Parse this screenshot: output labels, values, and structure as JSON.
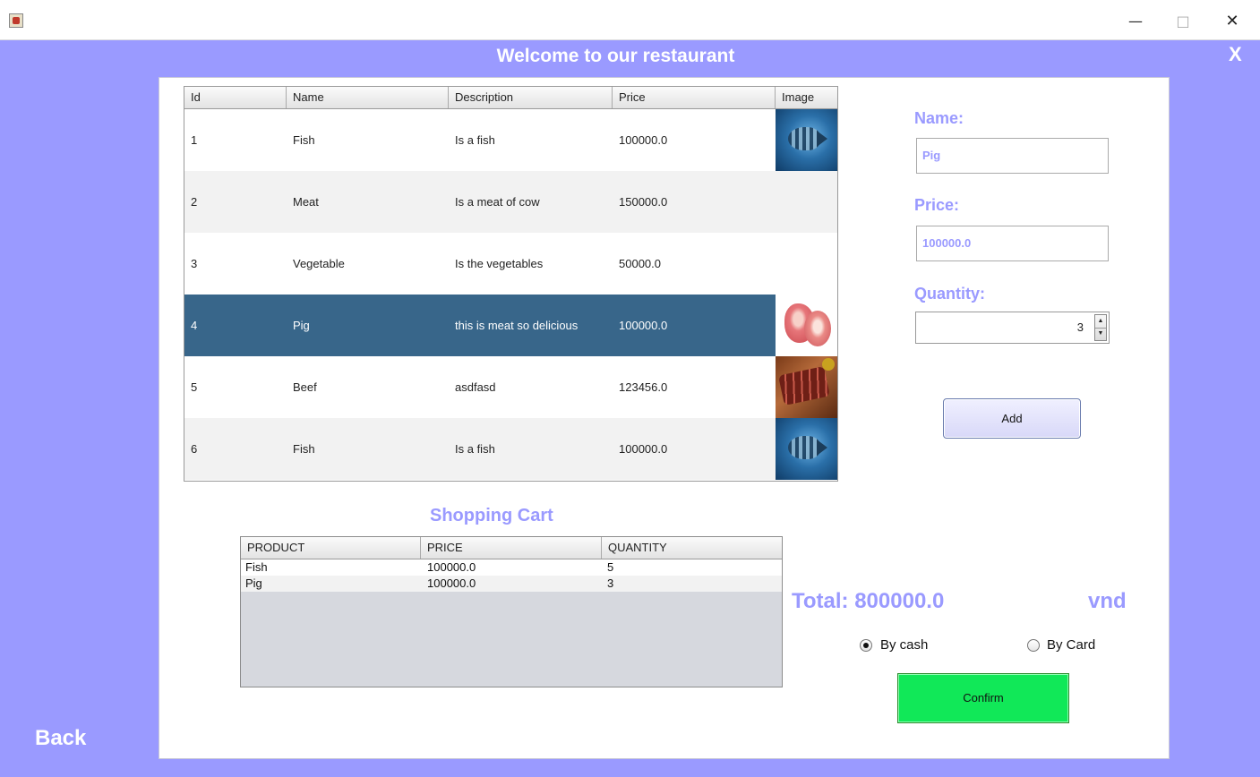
{
  "window": {
    "minimize_glyph": "—",
    "maximize_glyph": "□",
    "close_glyph": "✕"
  },
  "header": {
    "title": "Welcome to our restaurant",
    "close_label": "X"
  },
  "back_label": "Back",
  "menu_table": {
    "columns": [
      "Id",
      "Name",
      "Description",
      "Price",
      "Image"
    ],
    "rows": [
      {
        "id": "1",
        "name": "Fish",
        "description": "Is a fish",
        "price": "100000.0",
        "image": "fish-image"
      },
      {
        "id": "2",
        "name": "Meat",
        "description": "Is a meat of cow",
        "price": "150000.0",
        "image": ""
      },
      {
        "id": "3",
        "name": "Vegetable",
        "description": "Is the vegetables",
        "price": "50000.0",
        "image": ""
      },
      {
        "id": "4",
        "name": "Pig",
        "description": "this is meat so delicious",
        "price": "100000.0",
        "image": "pork-image"
      },
      {
        "id": "5",
        "name": "Beef",
        "description": "asdfasd",
        "price": "123456.0",
        "image": "beef-image"
      },
      {
        "id": "6",
        "name": "Fish",
        "description": "Is a fish",
        "price": "100000.0",
        "image": "fish-image"
      }
    ],
    "selected_row_index": 3
  },
  "form": {
    "name_label": "Name:",
    "name_value": "Pig",
    "price_label": "Price:",
    "price_value": "100000.0",
    "quantity_label": "Quantity:",
    "quantity_value": "3",
    "add_label": "Add"
  },
  "cart": {
    "title": "Shopping Cart",
    "columns": [
      "PRODUCT",
      "PRICE",
      "QUANTITY"
    ],
    "rows": [
      {
        "product": "Fish",
        "price": "100000.0",
        "quantity": "5"
      },
      {
        "product": "Pig",
        "price": "100000.0",
        "quantity": "3"
      }
    ]
  },
  "total": {
    "label": "Total: 800000.0",
    "currency": "vnd"
  },
  "payment": {
    "options": [
      {
        "label": "By cash",
        "selected": true
      },
      {
        "label": "By Card",
        "selected": false
      }
    ],
    "confirm_label": "Confirm"
  },
  "colors": {
    "background": "#9a9aff",
    "accent_text": "#9a9aff",
    "selected_row": "#38668a",
    "confirm": "#11e858"
  }
}
